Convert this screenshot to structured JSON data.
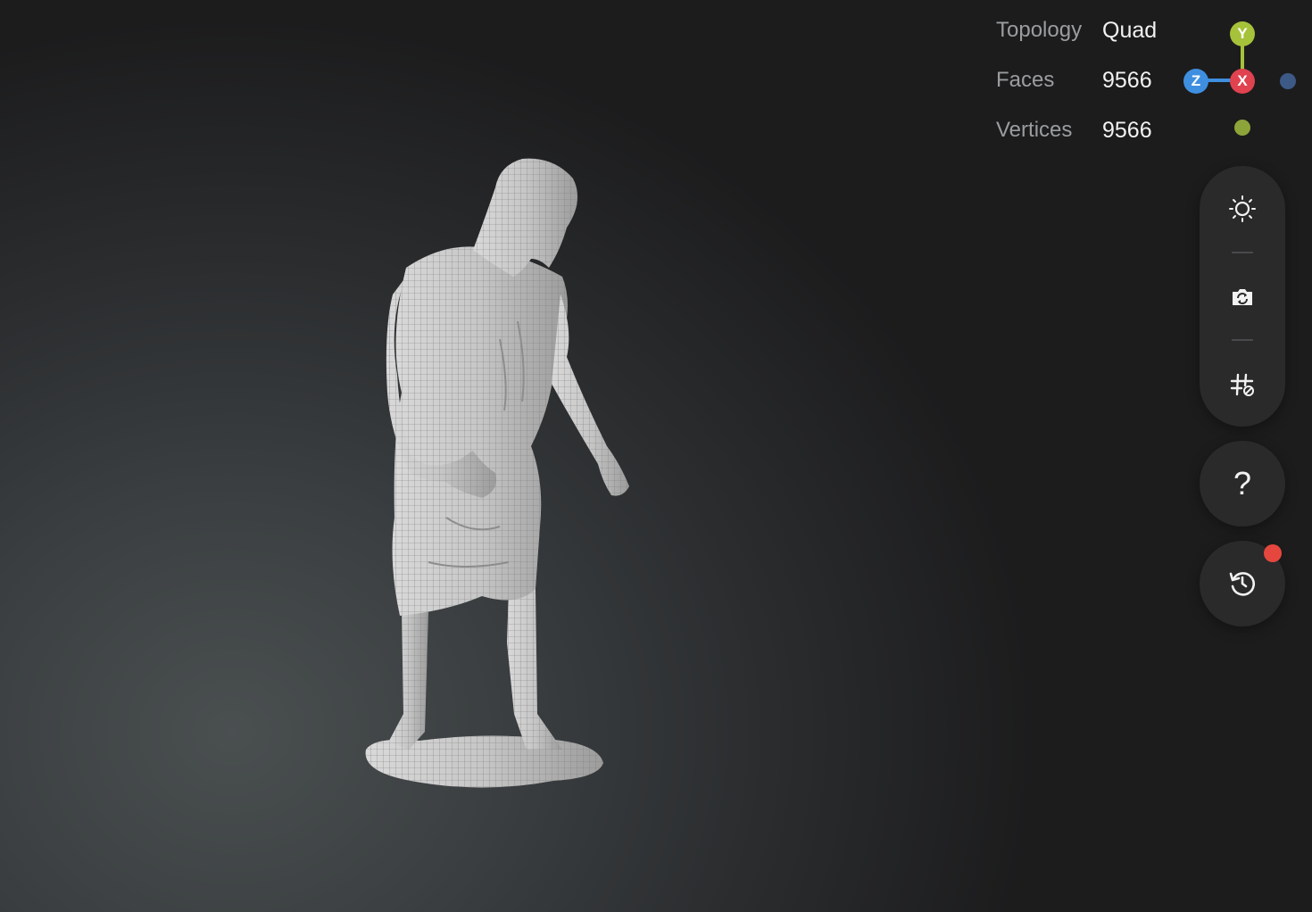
{
  "stats": {
    "topology_label": "Topology",
    "topology_value": "Quad",
    "faces_label": "Faces",
    "faces_value": "9566",
    "vertices_label": "Vertices",
    "vertices_value": "9566"
  },
  "gizmo": {
    "y_label": "Y",
    "x_label": "X",
    "z_label": "Z",
    "colors": {
      "y": "#a6c23a",
      "x": "#e0424f",
      "z": "#3f8fe0",
      "neg_x": "#3d5a86",
      "neg_y": "#8da43a"
    }
  },
  "toolbar": {
    "items": [
      {
        "icon": "sun-light-icon"
      },
      {
        "icon": "camera-switch-icon"
      },
      {
        "icon": "grid-toggle-icon"
      }
    ]
  },
  "help": {
    "label": "?",
    "icon": "help-icon"
  },
  "history": {
    "icon": "history-icon",
    "has_notification": true,
    "notification_color": "#e5473e"
  },
  "model": {
    "icon": "sculpted-figure-mesh"
  }
}
